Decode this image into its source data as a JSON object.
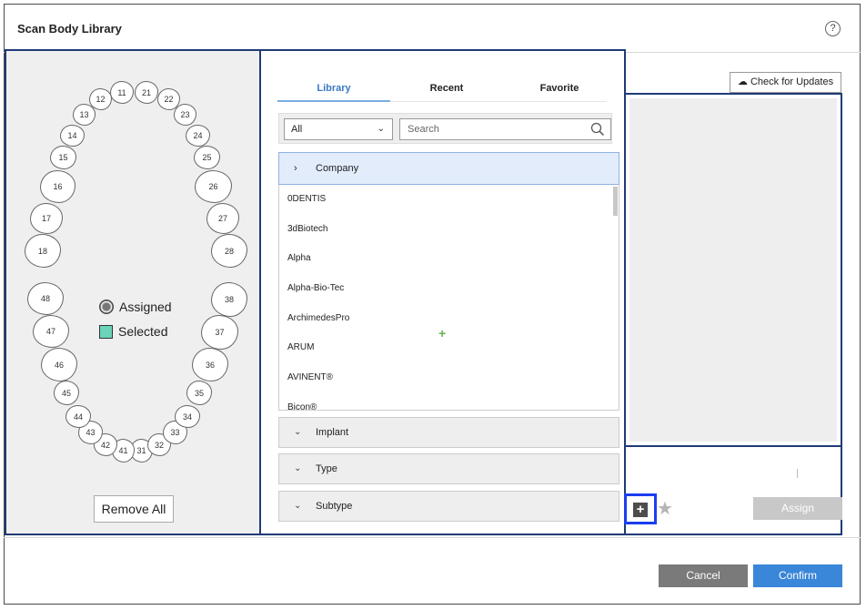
{
  "window": {
    "title": "Scan Body Library",
    "help": "?"
  },
  "teeth": {
    "upper": [
      "11",
      "12",
      "13",
      "14",
      "15",
      "16",
      "17",
      "18",
      "21",
      "22",
      "23",
      "24",
      "25",
      "26",
      "27",
      "28"
    ],
    "lower": [
      "31",
      "32",
      "33",
      "34",
      "35",
      "36",
      "37",
      "38",
      "41",
      "42",
      "43",
      "44",
      "45",
      "46",
      "47",
      "48"
    ],
    "legend": {
      "assigned": "Assigned",
      "selected": "Selected",
      "selected_color": "#6ad3b8"
    },
    "remove_all_label": "Remove All"
  },
  "tabs": [
    "Library",
    "Recent",
    "Favorite"
  ],
  "active_tab": "Library",
  "filter": {
    "category_value": "All",
    "search_placeholder": "Search"
  },
  "accordion": {
    "company_label": "Company",
    "companies": [
      "0DENTIS",
      "3dBiotech",
      "Alpha",
      "Alpha-Bio-Tec",
      "ArchimedesPro",
      "ARUM",
      "AVINENT®",
      "Bicon®"
    ],
    "implant_label": "Implant",
    "type_label": "Type",
    "subtype_label": "Subtype"
  },
  "right_panel": {
    "check_updates_label": "Check for Updates",
    "assign_label": "Assign"
  },
  "footer": {
    "cancel_label": "Cancel",
    "confirm_label": "Confirm"
  },
  "colors": {
    "panel_border": "#1f3b76",
    "accent_blue": "#3a86d8",
    "highlight_border": "#1a3ef0",
    "company_row_bg": "#e2ecfb"
  }
}
